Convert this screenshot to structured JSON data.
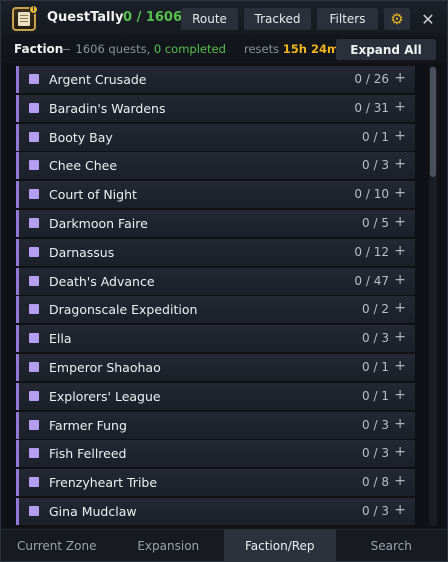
{
  "app": {
    "title": "QuestTally",
    "progress": "0 / 1606",
    "icon": "quest-scroll-icon",
    "badge": "!"
  },
  "toolbar": {
    "route_label": "Route",
    "tracked_label": "Tracked",
    "filters_label": "Filters",
    "settings_icon": "gear-icon",
    "settings_glyph": "⚙",
    "close_icon": "close-icon",
    "close_glyph": "✕"
  },
  "subheader": {
    "label": "Faction",
    "dash": "—",
    "quests_text": "1606 quests,",
    "completed_text": "0 completed",
    "resets_label": "resets",
    "resets_time": "15h 24m",
    "expand_label": "Expand All"
  },
  "factions": [
    {
      "name": "Argent Crusade",
      "count": "0 / 26"
    },
    {
      "name": "Baradin's Wardens",
      "count": "0 / 31"
    },
    {
      "name": "Booty Bay",
      "count": "0 / 1"
    },
    {
      "name": "Chee Chee",
      "count": "0 / 3"
    },
    {
      "name": "Court of Night",
      "count": "0 / 10"
    },
    {
      "name": "Darkmoon Faire",
      "count": "0 / 5"
    },
    {
      "name": "Darnassus",
      "count": "0 / 12"
    },
    {
      "name": "Death's Advance",
      "count": "0 / 47"
    },
    {
      "name": "Dragonscale Expedition",
      "count": "0 / 2"
    },
    {
      "name": "Ella",
      "count": "0 / 3"
    },
    {
      "name": "Emperor Shaohao",
      "count": "0 / 1"
    },
    {
      "name": "Explorers' League",
      "count": "0 / 1"
    },
    {
      "name": "Farmer Fung",
      "count": "0 / 3"
    },
    {
      "name": "Fish Fellreed",
      "count": "0 / 3"
    },
    {
      "name": "Frenzyheart Tribe",
      "count": "0 / 8"
    },
    {
      "name": "Gina Mudclaw",
      "count": "0 / 3"
    }
  ],
  "row_expand_glyph": "+",
  "tabs": [
    {
      "label": "Current Zone"
    },
    {
      "label": "Expansion"
    },
    {
      "label": "Faction/Rep",
      "active": true
    },
    {
      "label": "Search"
    }
  ],
  "colors": {
    "accent_green": "#57c24e",
    "accent_gold": "#f1b51c",
    "faction_marker": "#b49ef2",
    "row_border": "#8f78d8"
  }
}
